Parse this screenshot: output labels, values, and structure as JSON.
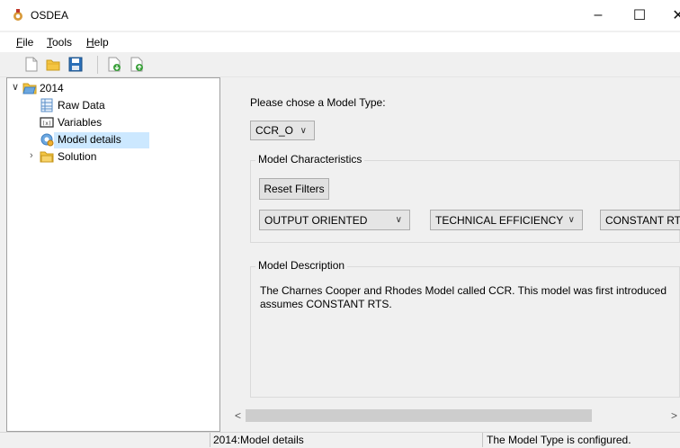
{
  "window": {
    "title": "OSDEA",
    "minimize_glyph": "–",
    "maximize_glyph": "☐",
    "close_glyph": "✕",
    "icon": "osdea-app-icon"
  },
  "menu": {
    "file_letter": "F",
    "file_rest": "ile",
    "tools_letter": "T",
    "tools_rest": "ools",
    "help_letter": "H",
    "help_rest": "elp"
  },
  "toolbar": {
    "icons": [
      "new-document-icon",
      "open-folder-icon",
      "save-icon",
      "import-icon",
      "export-icon"
    ]
  },
  "tree": {
    "root": {
      "label": "2014",
      "expanded": true,
      "icon": "folder-icon"
    },
    "children": [
      {
        "label": "Raw Data",
        "icon": "table-icon"
      },
      {
        "label": "Variables",
        "icon": "variables-icon"
      },
      {
        "label": "Model details",
        "icon": "gear-icon",
        "selected": true
      },
      {
        "label": "Solution",
        "icon": "folder-icon",
        "expanded": false
      }
    ]
  },
  "main": {
    "prompt": "Please chose a Model Type:",
    "model_type": "CCR_O",
    "characteristics": {
      "title": "Model Characteristics",
      "reset_label": "Reset Filters",
      "filters": [
        "OUTPUT ORIENTED",
        "TECHNICAL EFFICIENCY",
        "CONSTANT RTS"
      ]
    },
    "description": {
      "title": "Model Description",
      "line1": "The Charnes Cooper and Rhodes Model called CCR. This model was first introduced",
      "line2": "assumes CONSTANT RTS."
    }
  },
  "scrollbar": {
    "left_arrow": "<",
    "right_arrow": ">"
  },
  "status": {
    "left": "",
    "middle": "2014:Model details",
    "right": "The Model Type is configured."
  },
  "colors": {
    "selection": "#cce8ff",
    "folder": "#f4c542",
    "save": "#2a6fb8",
    "arrow_green": "#3aa03a"
  }
}
